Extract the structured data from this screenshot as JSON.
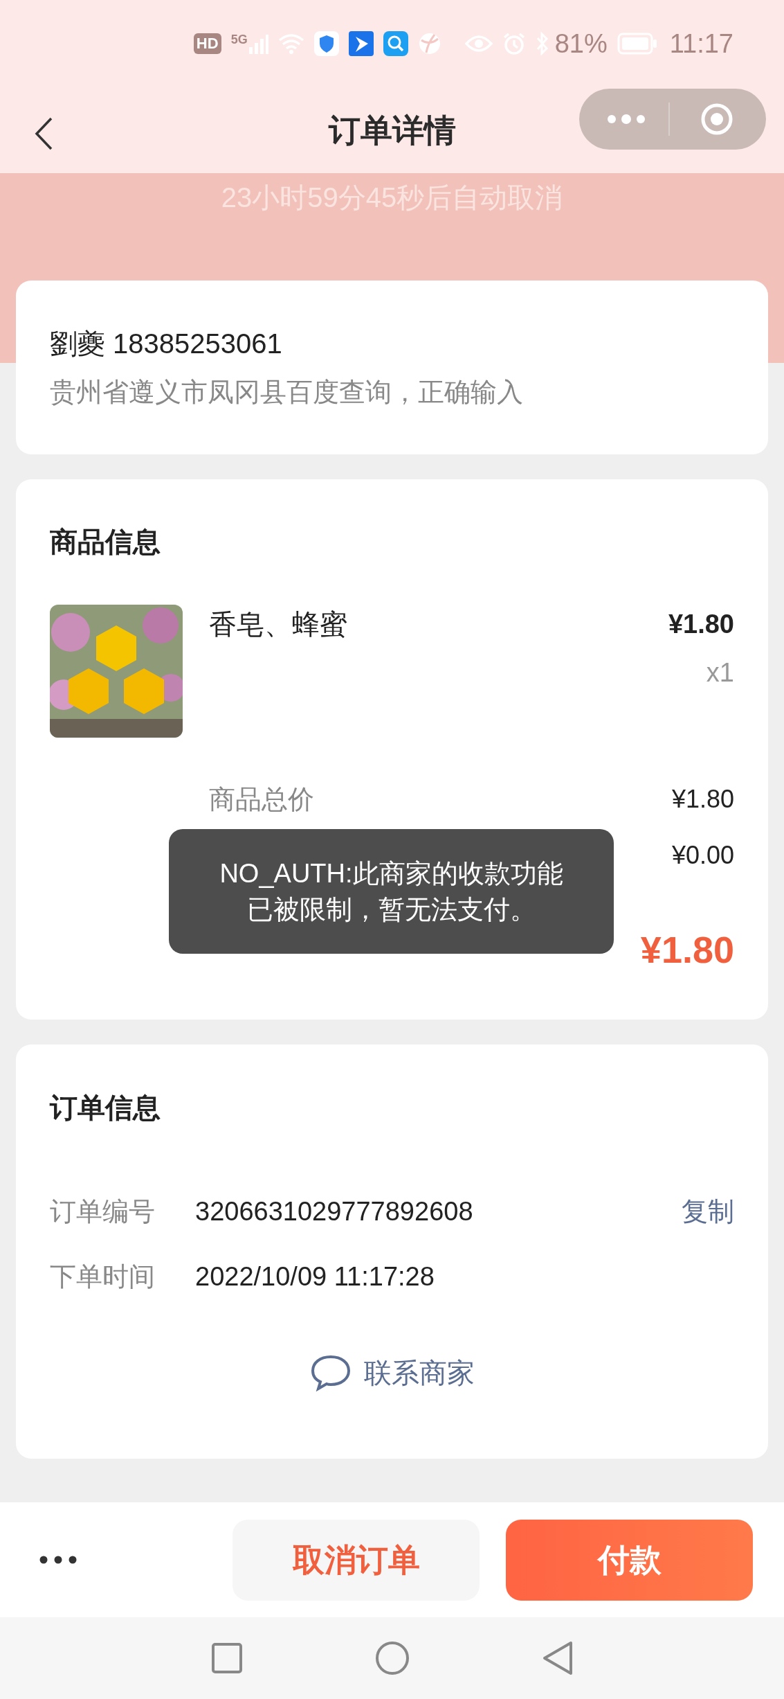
{
  "status_bar": {
    "hd": "HD",
    "network": "5G",
    "battery": "81%",
    "time": "11:17"
  },
  "nav": {
    "title": "订单详情"
  },
  "countdown": "23小时59分45秒后自动取消",
  "address": {
    "name_phone": "劉夔 18385253061",
    "address": "贵州省遵义市凤冈县百度查询，正确输入"
  },
  "goods": {
    "title": "商品信息",
    "items": [
      {
        "kind": "picture",
        "name": "香皂、蜂蜜",
        "price": "¥1.80",
        "quantity": "x1"
      }
    ],
    "summary": [
      {
        "label": "商品总价",
        "value": "¥1.80"
      },
      {
        "value": "¥0.00"
      }
    ],
    "total": {
      "amount": "¥1.80"
    }
  },
  "order_info": {
    "title": "订单信息",
    "rows": [
      {
        "label": "订单编号",
        "value": "3206631029777892608",
        "action": "复制"
      },
      {
        "label": "下单时间",
        "value": "2022/10/09 11:17:28"
      }
    ],
    "contact": "联系商家"
  },
  "toast": "NO_AUTH:此商家的收款功能已被限制，暂无法支付。",
  "actions": [
    {
      "label": "取消订单",
      "kind": "secondary"
    },
    {
      "label": "付款",
      "kind": "primary"
    }
  ]
}
